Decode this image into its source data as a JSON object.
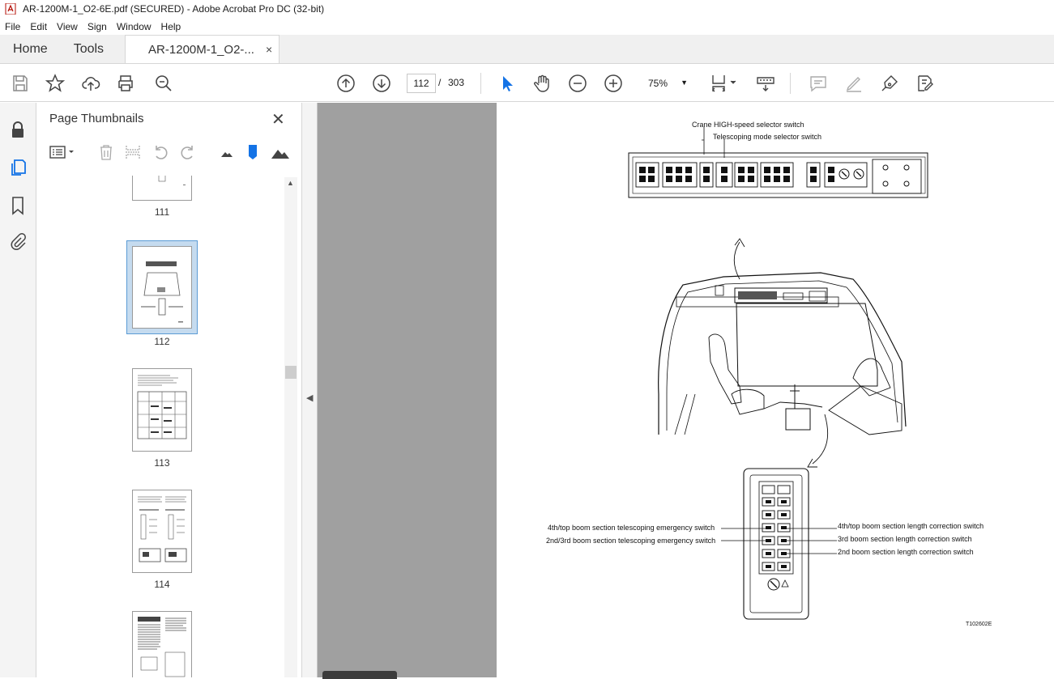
{
  "window": {
    "title": "AR-1200M-1_O2-6E.pdf (SECURED) - Adobe Acrobat Pro DC (32-bit)"
  },
  "menu": [
    "File",
    "Edit",
    "View",
    "Sign",
    "Window",
    "Help"
  ],
  "tabs": {
    "home": "Home",
    "tools": "Tools",
    "document": "AR-1200M-1_O2-...",
    "close": "×"
  },
  "toolbar": {
    "current_page": "112",
    "separator": "/",
    "total_pages": "303",
    "zoom": "75%"
  },
  "panel": {
    "title": "Page Thumbnails",
    "close": "✕",
    "thumbnails": [
      {
        "label": "111"
      },
      {
        "label": "112",
        "selected": true
      },
      {
        "label": "113"
      },
      {
        "label": "114"
      },
      {
        "label": ""
      }
    ]
  },
  "figure": {
    "label_high_speed": "Crane HIGH-speed selector switch",
    "label_telescoping": "Telescoping mode selector switch",
    "left_label_1": "4th/top boom section telescoping emergency switch",
    "left_label_2": "2nd/3rd boom section telescoping emergency switch",
    "right_label_1": "4th/top boom section length correction switch",
    "right_label_2": "3rd boom section length correction switch",
    "right_label_3": "2nd boom section length correction switch",
    "figure_id": "T102602E"
  },
  "colors": {
    "accent_blue": "#1473e6",
    "selection": "#c5dbef",
    "doc_background": "#a0a0a0"
  }
}
